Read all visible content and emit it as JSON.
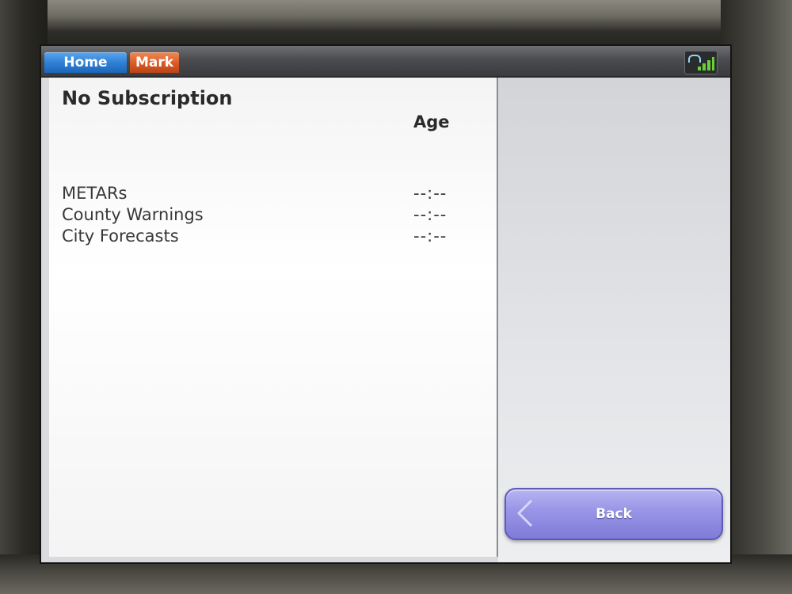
{
  "topbar": {
    "home_tab": "Home",
    "mark_tab": "Mark",
    "signal_icon": "satellite-signal-icon"
  },
  "main": {
    "title": "No Subscription",
    "age_header": "Age",
    "rows": [
      {
        "label": "METARs",
        "age": "--:--"
      },
      {
        "label": "County Warnings",
        "age": "--:--"
      },
      {
        "label": "City Forecasts",
        "age": "--:--"
      }
    ]
  },
  "side": {
    "back_label": "Back",
    "back_icon": "chevron-left-icon"
  },
  "colors": {
    "home_tab": "#2c7ed4",
    "mark_tab": "#d85a26",
    "back_button": "#9a97e8"
  }
}
